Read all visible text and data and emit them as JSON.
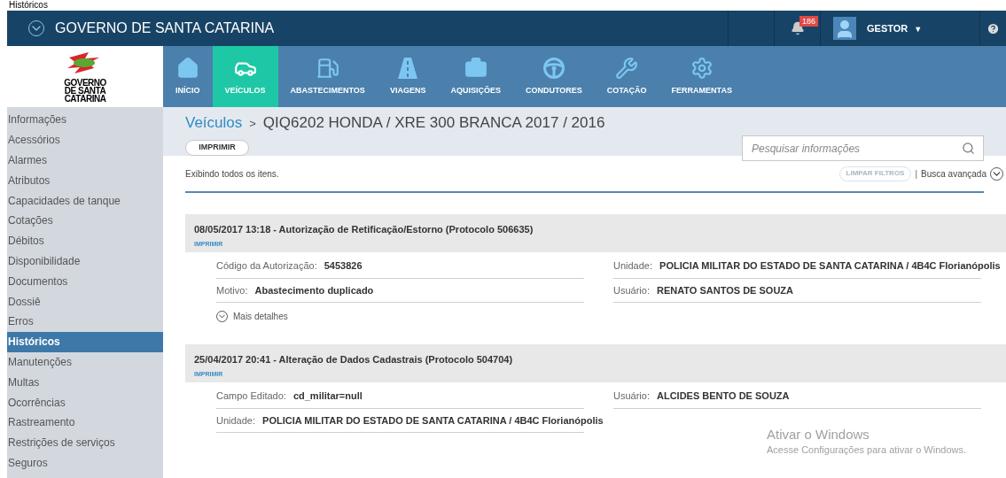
{
  "page_caption": "Históricos",
  "header": {
    "title": "GOVERNO DE SANTA CATARINA",
    "notifications": "186",
    "user": "GESTOR",
    "user_caret": "▼"
  },
  "logo": {
    "text": "GOVERNO DE SANTA CATARINA"
  },
  "nav": [
    {
      "label": "INÍCIO",
      "selected": false
    },
    {
      "label": "VEÍCULOS",
      "selected": true
    },
    {
      "label": "ABASTECIMENTOS",
      "selected": false
    },
    {
      "label": "VIAGENS",
      "selected": false
    },
    {
      "label": "AQUISIÇÕES",
      "selected": false
    },
    {
      "label": "CONDUTORES",
      "selected": false
    },
    {
      "label": "COTAÇÃO",
      "selected": false
    },
    {
      "label": "FERRAMENTAS",
      "selected": false
    }
  ],
  "sidebar": {
    "items": [
      {
        "label": "Informações",
        "selected": false
      },
      {
        "label": "Acessórios",
        "selected": false
      },
      {
        "label": "Alarmes",
        "selected": false
      },
      {
        "label": "Atributos",
        "selected": false
      },
      {
        "label": "Capacidades de tanque",
        "selected": false
      },
      {
        "label": "Cotações",
        "selected": false
      },
      {
        "label": "Débitos",
        "selected": false
      },
      {
        "label": "Disponibilidade",
        "selected": false
      },
      {
        "label": "Documentos",
        "selected": false
      },
      {
        "label": "Dossiê",
        "selected": false
      },
      {
        "label": "Erros",
        "selected": false
      },
      {
        "label": "Históricos",
        "selected": true
      },
      {
        "label": "Manutenções",
        "selected": false
      },
      {
        "label": "Multas",
        "selected": false
      },
      {
        "label": "Ocorrências",
        "selected": false
      },
      {
        "label": "Rastreamento",
        "selected": false
      },
      {
        "label": "Restrições de serviços",
        "selected": false
      },
      {
        "label": "Seguros",
        "selected": false
      }
    ]
  },
  "breadcrumb": {
    "parent": "Veículos",
    "separator": ">",
    "current": "QIQ6202 HONDA / XRE 300 BRANCA 2017 / 2016"
  },
  "print_button": "IMPRIMIR",
  "search": {
    "placeholder": "Pesquisar informações"
  },
  "filter_bar": {
    "summary": "Exibindo todos os itens.",
    "clear_button": "LIMPAR FILTROS",
    "clear_disabled": true,
    "separator": "|",
    "advanced": "Busca avançada"
  },
  "records": [
    {
      "title": "08/05/2017 13:18 - Autorização de Retificação/Estorno (Protocolo 506635)",
      "print": "IMPRIMIR",
      "left_fields": [
        {
          "label": "Código da Autorização:",
          "value": "5453826"
        },
        {
          "label": "Motivo:",
          "value": "Abastecimento duplicado"
        }
      ],
      "right_fields": [
        {
          "label": "Unidade:",
          "value": "POLICIA MILITAR DO ESTADO DE SANTA CATARINA / 4B4C Florianópolis"
        },
        {
          "label": "Usuário:",
          "value": "RENATO SANTOS DE SOUZA"
        }
      ],
      "more": "Mais detalhes"
    },
    {
      "title": "25/04/2017 20:41 - Alteração de Dados Cadastrais (Protocolo 504704)",
      "print": "IMPRIMIR",
      "left_fields": [
        {
          "label": "Campo Editado:",
          "value": "cd_militar=null"
        },
        {
          "label": "Unidade:",
          "value": "POLICIA MILITAR DO ESTADO DE SANTA CATARINA / 4B4C Florianópolis"
        }
      ],
      "right_fields": [
        {
          "label": "Usuário:",
          "value": "ALCIDES BENTO DE SOUZA"
        }
      ]
    }
  ],
  "os_overlay": {
    "title": "Ativar o Windows",
    "subtitle": "Acesse Configurações para ativar o Windows."
  }
}
